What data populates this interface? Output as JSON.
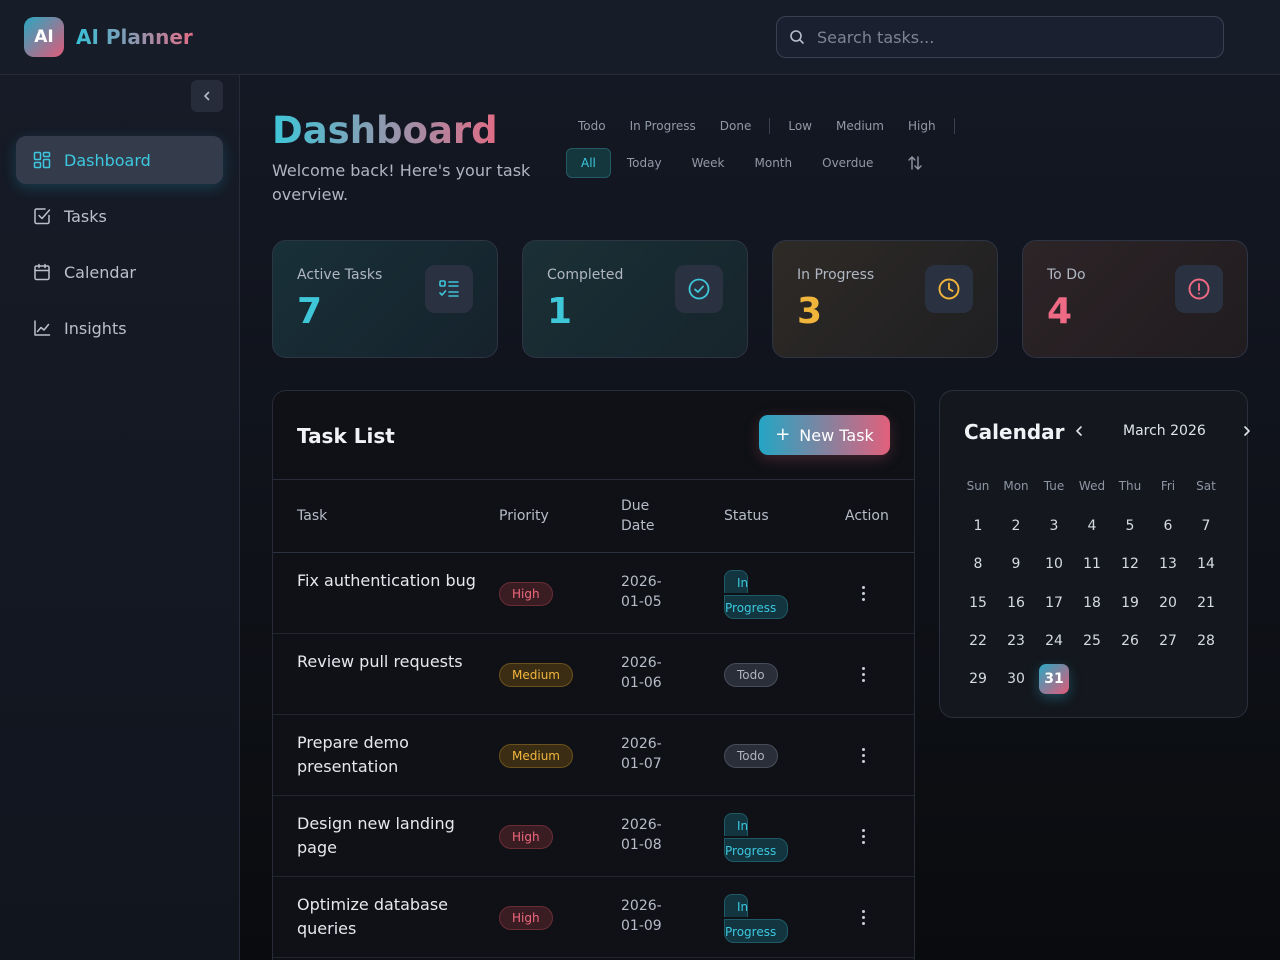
{
  "app": {
    "logo_text": "AI",
    "title": "AI Planner"
  },
  "search": {
    "placeholder": "Search tasks..."
  },
  "sidebar": {
    "items": [
      {
        "label": "Dashboard",
        "icon": "dashboard-icon",
        "active": true
      },
      {
        "label": "Tasks",
        "icon": "checkbox-icon"
      },
      {
        "label": "Calendar",
        "icon": "calendar-icon"
      },
      {
        "label": "Insights",
        "icon": "chart-line-icon"
      }
    ]
  },
  "page": {
    "title": "Dashboard",
    "subtitle": "Welcome back! Here's your task overview."
  },
  "filters": {
    "status": [
      "Todo",
      "In Progress",
      "Done"
    ],
    "priority": [
      "Low",
      "Medium",
      "High"
    ],
    "time": [
      "All",
      "Today",
      "Week",
      "Month",
      "Overdue"
    ],
    "active_time": "All"
  },
  "stats": {
    "active": {
      "label": "Active Tasks",
      "value": "7",
      "color": "#3ec6d9"
    },
    "completed": {
      "label": "Completed",
      "value": "1",
      "color": "#3ec6d9"
    },
    "in_progress": {
      "label": "In Progress",
      "value": "3",
      "color": "#f2b53c"
    },
    "todo": {
      "label": "To Do",
      "value": "4",
      "color": "#ef6a84"
    }
  },
  "task_list": {
    "title": "Task List",
    "new_button": "New Task",
    "columns": {
      "task": "Task",
      "priority": "Priority",
      "due_line1": "Due",
      "due_line2": "Date",
      "status": "Status",
      "action": "Action"
    },
    "rows": [
      {
        "name": "Fix authentication bug",
        "priority": "High",
        "due1": "2026-",
        "due2": "01-05",
        "status1": "In",
        "status2": "Progress"
      },
      {
        "name": "Review pull requests",
        "priority": "Medium",
        "due1": "2026-",
        "due2": "01-06",
        "status": "Todo"
      },
      {
        "name": "Prepare demo presentation",
        "priority": "Medium",
        "due1": "2026-",
        "due2": "01-07",
        "status": "Todo"
      },
      {
        "name": "Design new landing page",
        "priority": "High",
        "due1": "2026-",
        "due2": "01-08",
        "status1": "In",
        "status2": "Progress"
      },
      {
        "name": "Optimize database queries",
        "priority": "High",
        "due1": "2026-",
        "due2": "01-09",
        "status1": "In",
        "status2": "Progress"
      }
    ]
  },
  "calendar": {
    "title": "Calendar",
    "month": "March 2026",
    "weekdays": [
      "Sun",
      "Mon",
      "Tue",
      "Wed",
      "Thu",
      "Fri",
      "Sat"
    ],
    "days": [
      "1",
      "2",
      "3",
      "4",
      "5",
      "6",
      "7",
      "8",
      "9",
      "10",
      "11",
      "12",
      "13",
      "14",
      "15",
      "16",
      "17",
      "18",
      "19",
      "20",
      "21",
      "22",
      "23",
      "24",
      "25",
      "26",
      "27",
      "28",
      "29",
      "30",
      "31"
    ],
    "today": "31"
  }
}
